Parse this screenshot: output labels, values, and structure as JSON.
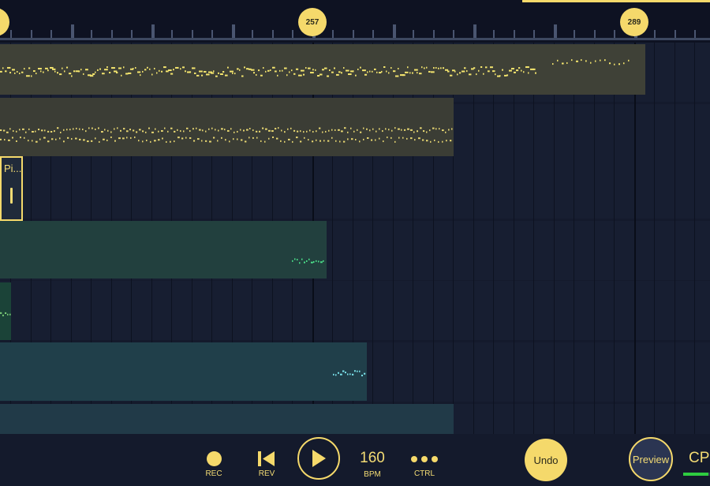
{
  "ruler": {
    "markers": [
      {
        "label": ""
      },
      {
        "label": "257"
      },
      {
        "label": "289"
      }
    ]
  },
  "tracks": [
    {
      "name": "",
      "color": "#3f4137",
      "note_color": "#f4e56e"
    },
    {
      "name": "",
      "color": "#3b3d35",
      "note_color": "#e8d772"
    },
    {
      "name": "",
      "color": "#1c2538",
      "note_color": "#f4dc74"
    },
    {
      "name": "",
      "color": "#22403e",
      "note_color": "#4be08a"
    },
    {
      "name": "",
      "color": "#1b4338",
      "note_color": "#7fd07a"
    },
    {
      "name": "",
      "color": "#203f4a",
      "note_color": "#7ee7f0"
    },
    {
      "name": "",
      "color": "#213a48",
      "note_color": "#7ee7f0"
    }
  ],
  "pattern_clip": {
    "label": "Pi..."
  },
  "transport": {
    "rec_label": "REC",
    "rev_label": "REV",
    "play_icon": "play-icon",
    "bpm_value": "160",
    "bpm_label": "BPM",
    "ctrl_label": "CTRL",
    "undo_label": "Undo",
    "preview_label": "Preview",
    "cpu_label": "CPU",
    "cpu_level": 0.95
  },
  "colors": {
    "accent": "#f5d96b",
    "background": "#141a2c",
    "cpu_meter": "#2ecc40"
  }
}
